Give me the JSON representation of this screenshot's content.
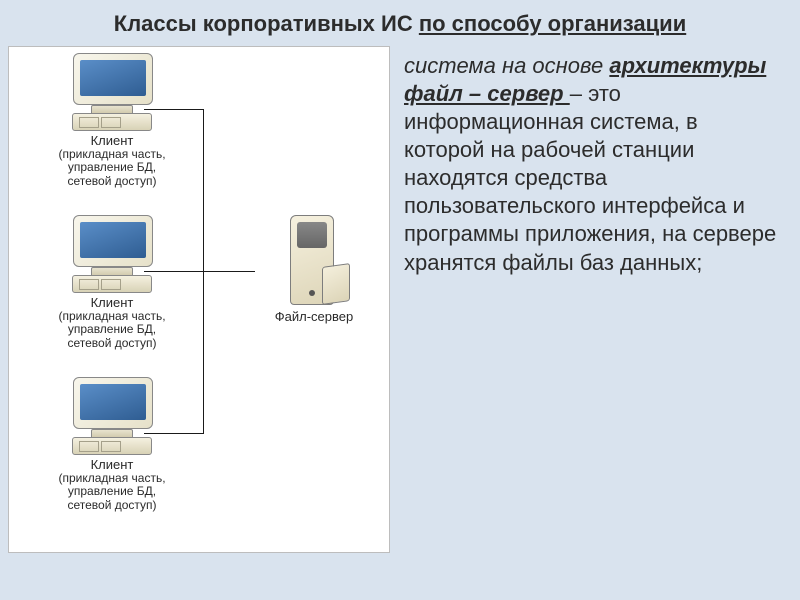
{
  "title": {
    "prefix": "Классы корпоративных ИС ",
    "emph": "по способу организации"
  },
  "diagram": {
    "client_label": "Клиент",
    "client_sub_l1": "(прикладная часть,",
    "client_sub_l2": "управление БД,",
    "client_sub_l3": "сетевой доступ)",
    "server_label": "Файл-сервер"
  },
  "description": {
    "lead": "система на основе ",
    "arch": "архитектуры файл – сервер ",
    "body": "– это информационная система, в которой на рабочей станции находятся средства пользовательского интерфейса и программы приложения, на сервере хранятся файлы баз данных;"
  }
}
